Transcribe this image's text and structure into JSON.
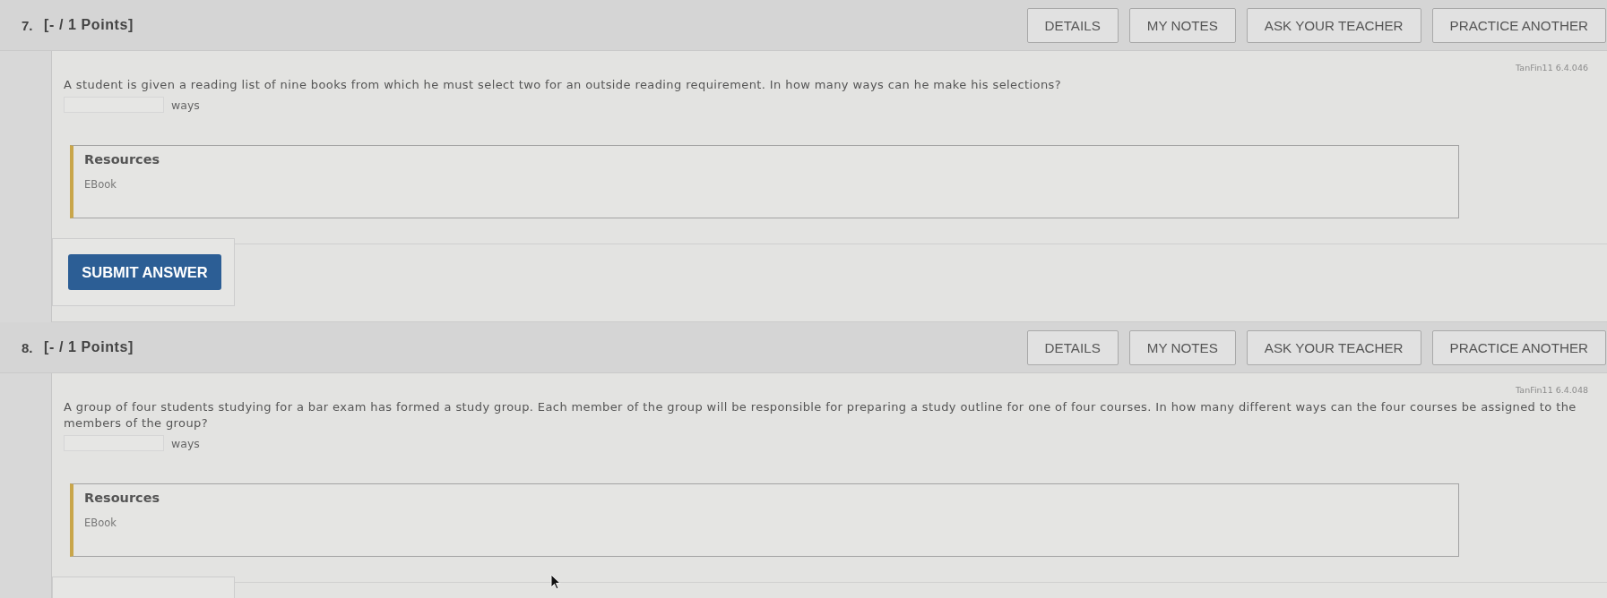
{
  "questions": [
    {
      "number": "7.",
      "points": "[- / 1 Points]",
      "buttons": [
        "DETAILS",
        "MY NOTES",
        "ASK YOUR TEACHER",
        "PRACTICE ANOTHER"
      ],
      "source": "TanFin11 6.4.046",
      "prompt": "A student is given a reading list of nine books from which he must select two for an outside reading requirement. In how many ways can he make his selections?",
      "answer": {
        "unit": "ways"
      },
      "resources": {
        "title": "Resources",
        "links": [
          "EBook"
        ]
      },
      "submit_button": "SUBMIT ANSWER"
    },
    {
      "number": "8.",
      "points": "[- / 1 Points]",
      "buttons": [
        "DETAILS",
        "MY NOTES",
        "ASK YOUR TEACHER",
        "PRACTICE ANOTHER"
      ],
      "source": "TanFin11 6.4.048",
      "prompt": "A group of four students studying for a bar exam has formed a study group. Each member of the group will be responsible for preparing a study outline for one of four courses. In how many different ways can the four courses be assigned to the members of the group?",
      "answer": {
        "unit": "ways"
      },
      "resources": {
        "title": "Resources",
        "links": [
          "EBook"
        ]
      }
    }
  ]
}
